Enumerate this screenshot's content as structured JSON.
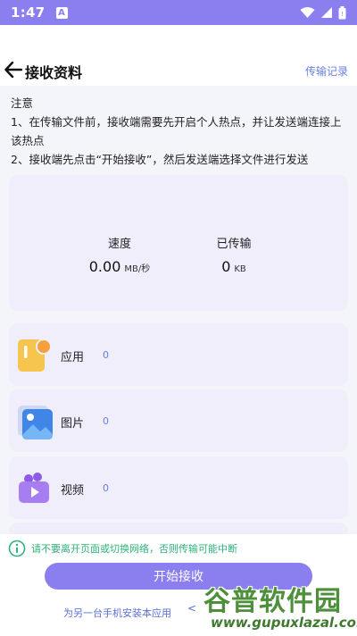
{
  "status_bar": {
    "time": "1:47",
    "notification_badge": "A"
  },
  "header": {
    "title": "接收资料",
    "history_link": "传输记录"
  },
  "notice": {
    "title": "注意",
    "lines": [
      "1、在传输文件前，接收端需要先开启个人热点，并让发送端连接上该热点",
      "2、接收端先点击“开始接收”，然后发送端选择文件进行发送"
    ]
  },
  "stats": {
    "speed_label": "速度",
    "speed_value": "0.00",
    "speed_unit": "MB/秒",
    "sent_label": "已传输",
    "sent_value": "0",
    "sent_unit": "KB"
  },
  "file_types": [
    {
      "label": "应用",
      "count": "0",
      "icon": "app-icon"
    },
    {
      "label": "图片",
      "count": "0",
      "icon": "image-icon"
    },
    {
      "label": "视频",
      "count": "0",
      "icon": "video-icon"
    }
  ],
  "bottom": {
    "warning": "请不要离开页面或切换网络，否则传输可能中断",
    "start_button": "开始接收",
    "install_link": "为另一台手机安装本应用",
    "install_arrow": "<"
  },
  "watermark": {
    "text": "谷普软件园",
    "url": "www.gupuxlazal.com"
  },
  "colors": {
    "accent": "#8b7ff0",
    "link": "#6a7fe0",
    "warning": "#2fb37a",
    "card": "#f0eefb"
  }
}
